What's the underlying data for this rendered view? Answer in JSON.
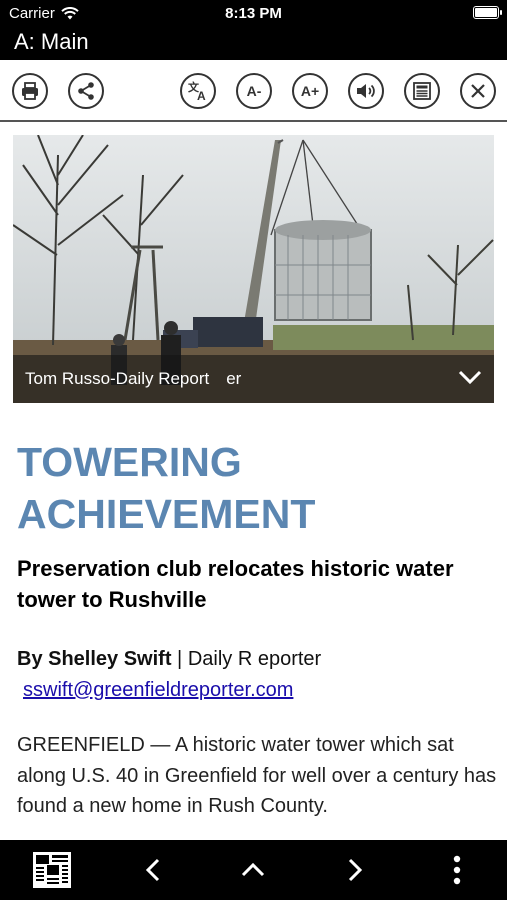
{
  "status_bar": {
    "carrier": "Carrier",
    "time": "8:13 PM"
  },
  "header": {
    "title": "A: Main"
  },
  "toolbar": {
    "buttons": [
      {
        "name": "print",
        "icon": "print-icon"
      },
      {
        "name": "share",
        "icon": "share-icon"
      },
      {
        "name": "translate",
        "icon": "translate-icon"
      },
      {
        "name": "decrease-font",
        "label": "A-"
      },
      {
        "name": "increase-font",
        "label": "A+"
      },
      {
        "name": "audio",
        "icon": "speaker-icon"
      },
      {
        "name": "page-view",
        "icon": "page-view-icon"
      },
      {
        "name": "close",
        "icon": "close-icon"
      }
    ]
  },
  "article": {
    "photo_caption": "Tom Russo-Daily Report er",
    "headline_line1": "TOWERING",
    "headline_line2": "ACHIEVEMENT",
    "subheadline": "Preservation club relocates historic water tower to Rushville",
    "byline_author": "By Shelley Swift",
    "byline_separator": " | ",
    "byline_org": "Daily R eporter",
    "email": "sswift@greenfieldreporter.com",
    "body": "GREENFIELD — A historic water tower which sat along U.S. 40 in Greenfield for well over a century has found a new home in Rush County."
  },
  "bottom_bar": {
    "items": [
      "newspaper-icon",
      "chevron-left-icon",
      "chevron-up-icon",
      "chevron-right-icon",
      "more-vertical-icon"
    ]
  },
  "colors": {
    "headline": "#5b86b1",
    "link": "#1a0dab",
    "bars": "#000000"
  }
}
